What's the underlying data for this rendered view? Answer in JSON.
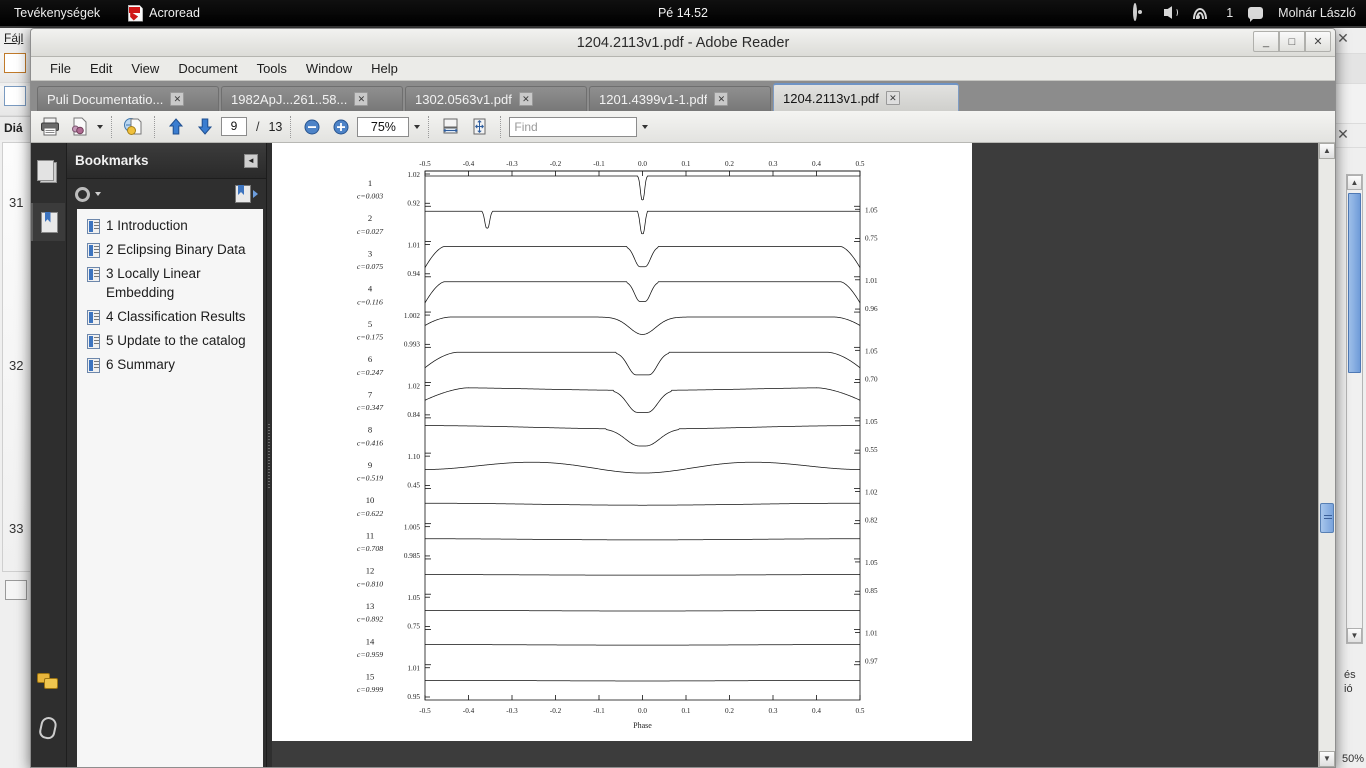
{
  "topbar": {
    "activities": "Tevékenységek",
    "app_name": "Acroread",
    "clock": "Pé 14.52",
    "battery_count": "1",
    "user": "Molnár László",
    "icons": [
      "acrobat-icon",
      "record-icon",
      "volume-icon",
      "wifi-icon",
      "message-icon"
    ]
  },
  "window": {
    "title": "1204.2113v1.pdf  -  Adobe Reader",
    "minimize": "_",
    "maximize": "□",
    "close": "✕"
  },
  "menubar": [
    "File",
    "Edit",
    "View",
    "Document",
    "Tools",
    "Window",
    "Help"
  ],
  "tabs": [
    {
      "label": "Puli Documentatio...",
      "active": false,
      "close": "✕"
    },
    {
      "label": "1982ApJ...261..58...",
      "active": false,
      "close": "✕"
    },
    {
      "label": "1302.0563v1.pdf",
      "active": false,
      "close": "✕"
    },
    {
      "label": "1201.4399v1-1.pdf",
      "active": false,
      "close": "✕"
    },
    {
      "label": "1204.2113v1.pdf",
      "active": true,
      "close": "✕"
    }
  ],
  "toolbar": {
    "print": "print-icon",
    "email": "email-icon",
    "save_copy": "save-copy-icon",
    "prev_page": "arrow-up-icon",
    "next_page": "arrow-down-icon",
    "page_current": "9",
    "page_sep": "/",
    "page_total": "13",
    "zoom_out": "zoom-out-icon",
    "zoom_in": "zoom-in-icon",
    "zoom_value": "75%",
    "fit_width": "fit-width-icon",
    "fit_page": "fit-page-icon",
    "find_placeholder": "Find",
    "find_value": ""
  },
  "sidebar": {
    "rail_icons": [
      "pages-icon",
      "bookmarks-icon",
      "comments-icon",
      "attachments-icon"
    ],
    "panel_title": "Bookmarks",
    "collapse": "◄",
    "options_icon": "gear-icon",
    "new_bookmark_icon": "new-bookmark-icon",
    "bookmarks": [
      "1 Introduction",
      "2 Eclipsing Binary Data",
      "3 Locally Linear Embedding",
      "4 Classification Results",
      "5 Update to the catalog",
      "6 Summary"
    ]
  },
  "background_left": {
    "menu_file": "Fájl",
    "panel_title": "Diá",
    "slide_numbers": [
      "31",
      "32",
      "33"
    ]
  },
  "background_right": {
    "close_label": "✕",
    "text_fragments": [
      "és",
      "ió"
    ],
    "zoom": "50%"
  },
  "chart_data": {
    "type": "line",
    "title": "",
    "xlabel": "Phase",
    "ylabel": "",
    "x_ticks": [
      -0.5,
      -0.4,
      -0.3,
      -0.2,
      -0.1,
      0.0,
      0.1,
      0.2,
      0.3,
      0.4,
      0.5
    ],
    "x_tick_labels": [
      "-0.5",
      "-0.4",
      "-0.3",
      "-0.2",
      "-0.1",
      "0.0",
      "0.1",
      "0.2",
      "0.3",
      "0.4",
      "0.5"
    ],
    "x_axis_top": true,
    "x_axis_bottom": true,
    "xlim": [
      -0.5,
      0.5
    ],
    "grid": false,
    "legend": "none",
    "panel_count": 15,
    "panels": [
      {
        "index": "1",
        "label": "c=0.003",
        "y_left_top": "1.02",
        "y_left_bottom": "0.92",
        "y_right_top": "",
        "y_right_bottom": "",
        "shape": "flat-with-narrow-primary-eclipse",
        "primary_phase": 0.0,
        "primary_depth": 0.85,
        "secondary_phase": null,
        "secondary_depth": 0
      },
      {
        "index": "2",
        "label": "c=0.027",
        "y_left_top": "",
        "y_left_bottom": "",
        "y_right_top": "1.05",
        "y_right_bottom": "0.75",
        "shape": "flat-with-narrow-primary-and-secondary",
        "primary_phase": 0.0,
        "primary_depth": 0.8,
        "secondary_phase": -0.357,
        "secondary_depth": 0.6
      },
      {
        "index": "3",
        "label": "c=0.075",
        "y_left_top": "1.01",
        "y_left_bottom": "0.94",
        "y_right_top": "",
        "y_right_bottom": "",
        "shape": "detached-narrow-eclipse",
        "primary_phase": 0.0,
        "primary_depth": 0.72,
        "secondary_phase": null,
        "secondary_depth": 0
      },
      {
        "index": "4",
        "label": "c=0.116",
        "y_left_top": "",
        "y_left_bottom": "",
        "y_right_top": "1.01",
        "y_right_bottom": "0.96",
        "shape": "detached-narrow-eclipse",
        "primary_phase": 0.0,
        "primary_depth": 0.7,
        "secondary_phase": null,
        "secondary_depth": 0
      },
      {
        "index": "5",
        "label": "c=0.175",
        "y_left_top": "1.002",
        "y_left_bottom": "0.993",
        "y_right_top": "",
        "y_right_bottom": "",
        "shape": "shallow-rounded-eclipse",
        "primary_phase": 0.0,
        "primary_depth": 0.62,
        "secondary_phase": null,
        "secondary_depth": 0
      },
      {
        "index": "6",
        "label": "c=0.247",
        "y_left_top": "",
        "y_left_bottom": "",
        "y_right_top": "1.05",
        "y_right_bottom": "0.70",
        "shape": "wide-eclipse-flat-top",
        "primary_phase": 0.0,
        "primary_depth": 0.8,
        "secondary_phase": null,
        "secondary_depth": 0
      },
      {
        "index": "7",
        "label": "c=0.347",
        "y_left_top": "1.02",
        "y_left_bottom": "0.84",
        "y_right_top": "",
        "y_right_bottom": "",
        "shape": "broad-eclipse-rounded-shoulders",
        "primary_phase": 0.0,
        "primary_depth": 0.78,
        "secondary_phase": null,
        "secondary_depth": 0
      },
      {
        "index": "8",
        "label": "c=0.416",
        "y_left_top": "",
        "y_left_bottom": "",
        "y_right_top": "1.05",
        "y_right_bottom": "0.55",
        "shape": "broad-eclipse-with-curved-max",
        "primary_phase": 0.0,
        "primary_depth": 0.6,
        "secondary_phase": null,
        "secondary_depth": 0
      },
      {
        "index": "9",
        "label": "c=0.519",
        "y_left_top": "1.10",
        "y_left_bottom": "0.45",
        "y_right_top": "",
        "y_right_bottom": "",
        "shape": "ew-type-shallow",
        "primary_phase": 0.0,
        "primary_depth": 0.45,
        "secondary_phase": null,
        "secondary_depth": 0
      },
      {
        "index": "10",
        "label": "c=0.622",
        "y_left_top": "",
        "y_left_bottom": "",
        "y_right_top": "1.02",
        "y_right_bottom": "0.82",
        "shape": "ew-type-sinusoidal",
        "primary_phase": 0.0,
        "primary_depth": 0.42,
        "secondary_phase": 0.5,
        "secondary_depth": 0.35
      },
      {
        "index": "11",
        "label": "c=0.708",
        "y_left_top": "1.005",
        "y_left_bottom": "0.985",
        "y_right_top": "",
        "y_right_bottom": "",
        "shape": "sinusoidal",
        "primary_phase": 0.0,
        "primary_depth": 0.4,
        "secondary_phase": 0.5,
        "secondary_depth": 0.36
      },
      {
        "index": "12",
        "label": "c=0.810",
        "y_left_top": "",
        "y_left_bottom": "",
        "y_right_top": "1.05",
        "y_right_bottom": "0.85",
        "shape": "sinusoidal",
        "primary_phase": 0.0,
        "primary_depth": 0.4,
        "secondary_phase": 0.5,
        "secondary_depth": 0.38
      },
      {
        "index": "13",
        "label": "c=0.892",
        "y_left_top": "1.05",
        "y_left_bottom": "0.75",
        "y_right_top": "",
        "y_right_bottom": "",
        "shape": "sinusoidal",
        "primary_phase": 0.0,
        "primary_depth": 0.42,
        "secondary_phase": 0.5,
        "secondary_depth": 0.4
      },
      {
        "index": "14",
        "label": "c=0.959",
        "y_left_top": "",
        "y_left_bottom": "",
        "y_right_top": "1.01",
        "y_right_bottom": "0.97",
        "shape": "sinusoidal",
        "primary_phase": 0.0,
        "primary_depth": 0.38,
        "secondary_phase": 0.5,
        "secondary_depth": 0.36
      },
      {
        "index": "15",
        "label": "c=0.999",
        "y_left_top": "1.01",
        "y_left_bottom": "0.95",
        "y_right_top": "",
        "y_right_bottom": "",
        "shape": "sinusoidal",
        "primary_phase": 0.0,
        "primary_depth": 0.4,
        "secondary_phase": 0.5,
        "secondary_depth": 0.38
      }
    ]
  }
}
